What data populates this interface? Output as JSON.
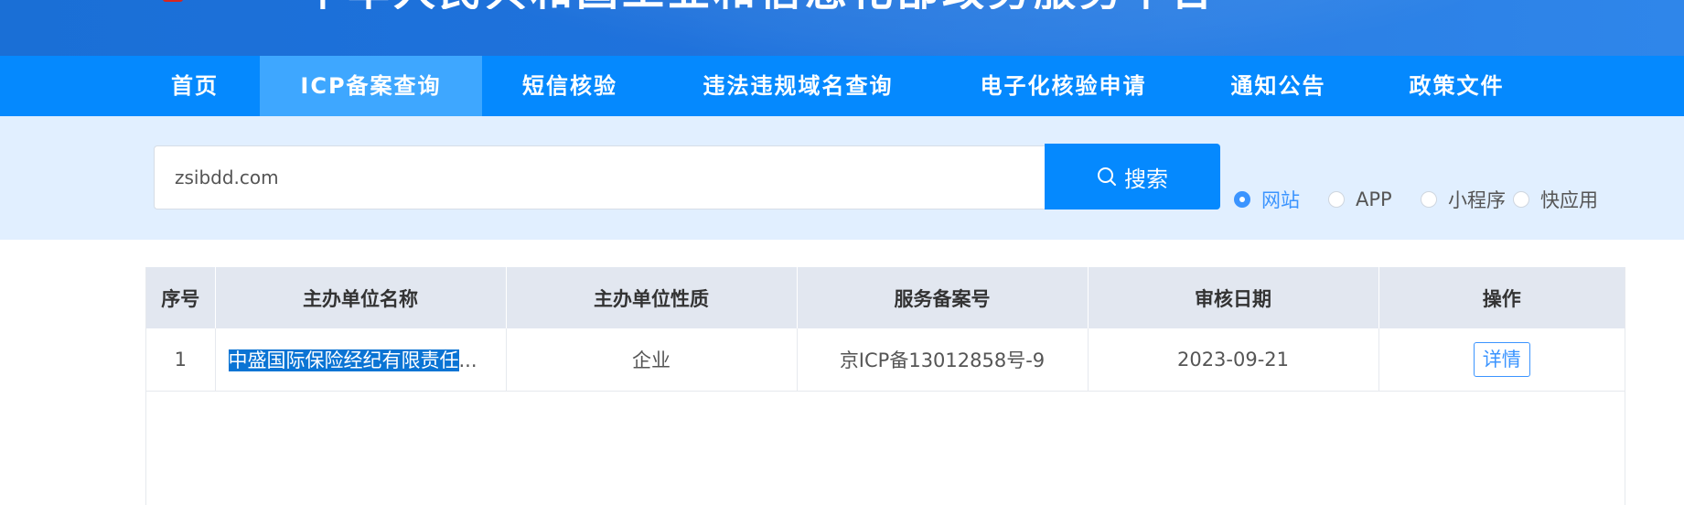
{
  "banner": {
    "title": "中华人民共和国工业和信息化部政务服务平台"
  },
  "nav": {
    "items": [
      {
        "label": "首页"
      },
      {
        "label": "ICP备案查询"
      },
      {
        "label": "短信核验"
      },
      {
        "label": "违法违规域名查询"
      },
      {
        "label": "电子化核验申请"
      },
      {
        "label": "通知公告"
      },
      {
        "label": "政策文件"
      }
    ],
    "active_index": 1
  },
  "search": {
    "value": "zsibdd.com",
    "button_label": "搜索",
    "search_icon": "search-icon"
  },
  "filters": {
    "options": [
      {
        "label": "网站",
        "checked": true
      },
      {
        "label": "APP",
        "checked": false
      },
      {
        "label": "小程序",
        "checked": false
      },
      {
        "label": "快应用",
        "checked": false
      }
    ]
  },
  "table": {
    "headers": [
      "序号",
      "主办单位名称",
      "主办单位性质",
      "服务备案号",
      "审核日期",
      "操作"
    ],
    "rows": [
      {
        "index": "1",
        "name": "中盛国际保险经纪有限责任",
        "name_ellipsis": "...",
        "nature": "企业",
        "record_no": "京ICP备13012858号-9",
        "date": "2023-09-21",
        "action": "详情"
      }
    ]
  },
  "colors": {
    "nav_bg": "#0589fe",
    "nav_active": "#3ea7ff",
    "search_band": "#e1efff",
    "accent": "#3b94ff",
    "table_header": "#e2e7f0"
  }
}
